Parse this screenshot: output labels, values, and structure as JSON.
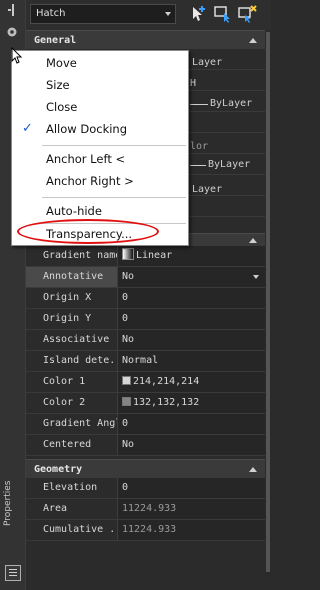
{
  "combo": {
    "value": "Hatch"
  },
  "strip": {
    "vertical_label": "Properties"
  },
  "sections": {
    "general": {
      "title": "General"
    },
    "pattern": {
      "rows": [
        {
          "key": "Gradient name",
          "value": "Linear"
        },
        {
          "key": "Annotative",
          "value": "No"
        },
        {
          "key": "Origin X",
          "value": "0"
        },
        {
          "key": "Origin Y",
          "value": "0"
        },
        {
          "key": "Associative",
          "value": "No"
        },
        {
          "key": "Island dete...",
          "value": "Normal"
        },
        {
          "key": "Color 1",
          "value": "214,214,214",
          "swatch": "#d6d6d6"
        },
        {
          "key": "Color 2",
          "value": "132,132,132",
          "swatch": "#848484"
        },
        {
          "key": "Gradient Angle",
          "value": "0"
        },
        {
          "key": "Centered",
          "value": "No"
        }
      ]
    },
    "geometry": {
      "title": "Geometry",
      "rows": [
        {
          "key": "Elevation",
          "value": "0"
        },
        {
          "key": "Area",
          "value": "11224.933"
        },
        {
          "key": "Cumulative ...",
          "value": "11224.933"
        }
      ]
    }
  },
  "behind_menu": {
    "layer1": "Layer",
    "layer2": "H",
    "bylayer1": "ByLayer",
    "lor": "lor",
    "bylayer2": "ByLayer",
    "layer3": "Layer"
  },
  "menu": {
    "items": [
      {
        "label": "Move"
      },
      {
        "label": "Size"
      },
      {
        "label": "Close"
      },
      {
        "label": "Allow Docking",
        "checked": true
      },
      {
        "label": "Anchor Left <"
      },
      {
        "label": "Anchor Right >"
      },
      {
        "label": "Auto-hide"
      },
      {
        "label": "Transparency..."
      }
    ],
    "check_glyph": "✓"
  },
  "colors": {
    "annotation_oval": "#e01010",
    "check": "#1a5bd6"
  }
}
